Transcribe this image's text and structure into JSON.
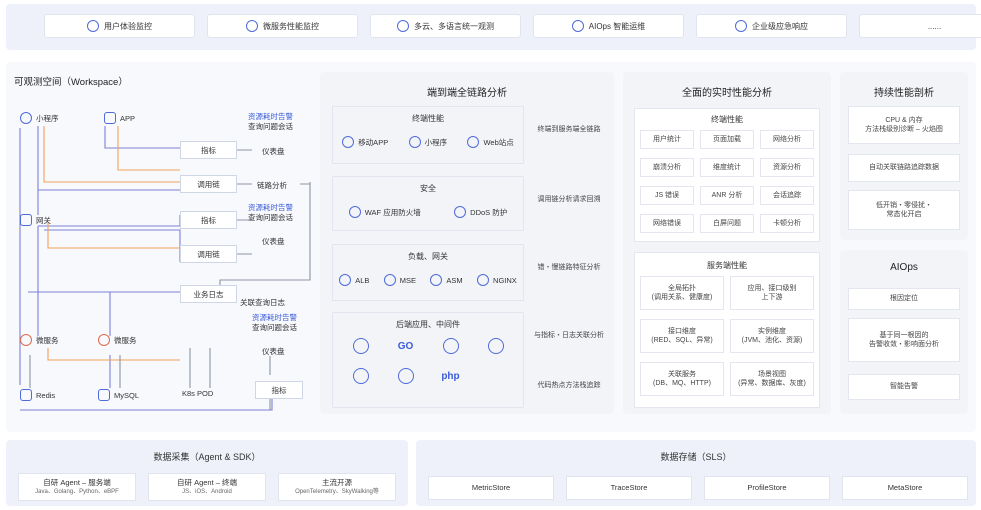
{
  "top_bar": [
    {
      "label": "用户体验监控",
      "icon": "user-icon"
    },
    {
      "label": "微服务性能监控",
      "icon": "chart-icon"
    },
    {
      "label": "多云、多语言统一观测",
      "icon": "cloud-icon"
    },
    {
      "label": "AIOps 智能运维",
      "icon": "ai-icon"
    },
    {
      "label": "企业级应急响应",
      "icon": "alarm-icon"
    },
    {
      "label": "......",
      "icon": ""
    }
  ],
  "workspace": {
    "title": "可观测空间（Workspace）",
    "nodes": {
      "mini_program": "小程序",
      "app": "APP",
      "gateway": "网关",
      "microservice_1": "微服务",
      "microservice_2": "微服务",
      "redis": "Redis",
      "mysql": "MySQL",
      "k8s_pod": "K8s POD"
    },
    "boxes": {
      "metrics_1": "指标",
      "trace_1": "调用链",
      "metrics_2": "指标",
      "trace_2": "调用链",
      "business_log": "业务日志",
      "metrics_3": "指标"
    },
    "labels": {
      "dashboard_1": "仪表盘",
      "trace_analysis": "链路分析",
      "dashboard_2": "仪表盘",
      "log_query": "关联查询日志",
      "dashboard_3": "仪表盘"
    },
    "alerts": [
      {
        "line1": "资源耗时告警",
        "line2": "查询问题会话"
      },
      {
        "line1": "资源耗时告警",
        "line2": "查询问题会话"
      },
      {
        "line1": "资源耗时告警",
        "line2": "查询问题会话"
      }
    ]
  },
  "e2e_panel": {
    "title": "端到端全链路分析",
    "sections": [
      {
        "title": "终端性能",
        "items": [
          {
            "label": "移动APP",
            "icon": "mobile-icon"
          },
          {
            "label": "小程序",
            "icon": "miniprogram-icon"
          },
          {
            "label": "Web站点",
            "icon": "web-icon"
          }
        ],
        "side": "终端到服务端全链路"
      },
      {
        "title": "安全",
        "items": [
          {
            "label": "WAF 应用防火墙",
            "icon": "shield-icon"
          },
          {
            "label": "DDoS 防护",
            "icon": "ddos-icon"
          }
        ],
        "side": "调用链分析请求回溯"
      },
      {
        "title": "负载、网关",
        "items": [
          {
            "label": "ALB",
            "icon": "alb-icon"
          },
          {
            "label": "MSE",
            "icon": "mse-icon"
          },
          {
            "label": "ASM",
            "icon": "asm-icon"
          },
          {
            "label": "NGINX",
            "icon": "nginx-icon"
          }
        ],
        "side": "错・慢链路特征分析"
      },
      {
        "title": "后端应用、中间件",
        "items": [
          {
            "label": "",
            "icon": "java-icon"
          },
          {
            "label": "GO",
            "icon": "go-icon"
          },
          {
            "label": "",
            "icon": "python-icon"
          },
          {
            "label": "",
            "icon": "nodejs-icon"
          },
          {
            "label": "",
            "icon": "dotnet-icon"
          },
          {
            "label": "",
            "icon": "stack-icon"
          },
          {
            "label": "php",
            "icon": "php-icon"
          }
        ],
        "side": "与指标・日志关联分析"
      }
    ],
    "side_last": "代码热点方法栈追踪"
  },
  "realtime_panel": {
    "title": "全面的实时性能分析",
    "terminal": {
      "title": "终端性能",
      "cells": [
        "用户统计",
        "页面加载",
        "网络分析",
        "崩溃分析",
        "维度统计",
        "资源分析",
        "JS 错误",
        "ANR 分析",
        "会话追踪",
        "网络错误",
        "白屏问题",
        "卡顿分析"
      ]
    },
    "service": {
      "title": "服务端性能",
      "cells": [
        "全局拓扑\n(调用关系、健康度)",
        "应用、接口级别\n上下游",
        "接口维度\n(RED、SQL、异常)",
        "实例维度\n(JVM、池化、资源)",
        "关联服务\n(DB、MQ、HTTP)",
        "场景视图\n(异常、数据库、灰度)"
      ]
    }
  },
  "profiling_panel": {
    "title": "持续性能剖析",
    "items": [
      "CPU & 内存\n方法栈级别诊断 – 火焰图",
      "自动关联链路追踪数据",
      "低开销・零侵扰・\n常态化开启"
    ]
  },
  "aiops_panel": {
    "title": "AIOps",
    "items": [
      "根因定位",
      "基于同一根因的\n告警收敛・影响面分析",
      "智能告警"
    ]
  },
  "collection": {
    "title": "数据采集（Agent & SDK）",
    "tiles": [
      {
        "title": "自研 Agent – 服务端",
        "sub": "Java、Golang、Python、eBPF"
      },
      {
        "title": "自研 Agent – 终端",
        "sub": "JS、iOS、Android"
      },
      {
        "title": "主流开源",
        "sub": "OpenTelemetry、SkyWalking等"
      }
    ]
  },
  "storage": {
    "title": "数据存储（SLS）",
    "tiles": [
      "MetricStore",
      "TraceStore",
      "ProfileStore",
      "MetaStore"
    ]
  },
  "colors": {
    "accent": "#3a5bd9",
    "orange": "#f0a25a",
    "purple": "#7d7fd6",
    "gray": "#8c95a6"
  }
}
